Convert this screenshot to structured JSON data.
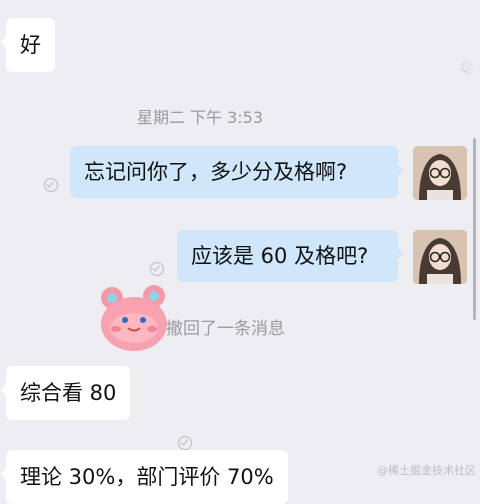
{
  "messages": {
    "m1": "好",
    "m2": "忘记问你了，多少分及格啊?",
    "m3": "应该是 60 及格吧?",
    "m4": "综合看 80",
    "m5": "理论 30%，部门评价 70%"
  },
  "timestamp": "星期二 下午 3:53",
  "recalled_notice": "撤回了一条消息",
  "watermark": "@稀土掘金技术社区",
  "ghost_mark": "初",
  "colors": {
    "background": "#ededf2",
    "incoming_bubble": "#ffffff",
    "outgoing_bubble": "#cfe6fb",
    "muted_text": "#9a9aa0"
  },
  "icons": {
    "read_receipt": "check-circle-icon",
    "sticker": "pink-bear-sticker"
  }
}
